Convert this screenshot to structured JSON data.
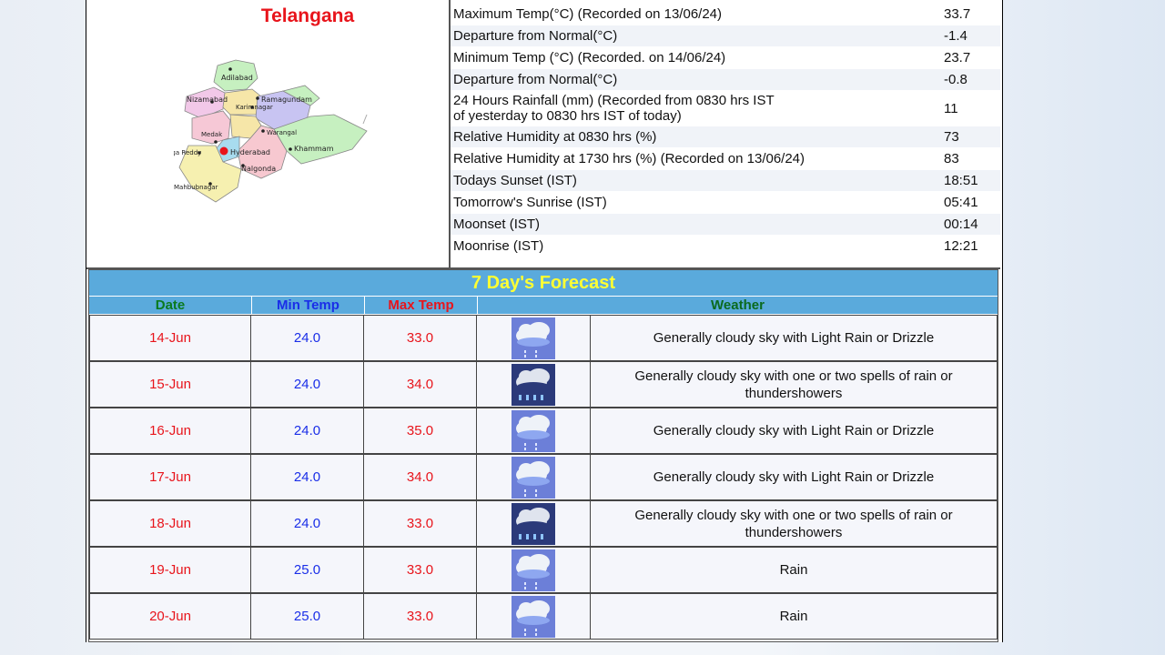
{
  "map": {
    "title": "Telangana",
    "places": [
      "Adilabad",
      "Nizamabad",
      "Ramagundam",
      "Karimnagar",
      "Warangal",
      "Medak",
      "Ranga Reddy",
      "Hyderabad",
      "Khammam",
      "Nalgonda",
      "Mahbubnagar"
    ]
  },
  "observations": [
    {
      "label": "Maximum Temp(°C) (Recorded on 13/06/24)",
      "value": "33.7"
    },
    {
      "label": "Departure from Normal(°C)",
      "value": "-1.4"
    },
    {
      "label": "Minimum Temp (°C) (Recorded. on 14/06/24)",
      "value": "23.7"
    },
    {
      "label": "Departure from Normal(°C)",
      "value": "-0.8"
    },
    {
      "label": "24 Hours Rainfall (mm) (Recorded from 0830 hrs IST",
      "label2": "of yesterday to 0830 hrs IST of today)",
      "value": "11"
    },
    {
      "label": "Relative Humidity at 0830 hrs (%)",
      "value": "73"
    },
    {
      "label": "Relative Humidity at 1730 hrs (%) (Recorded on 13/06/24)",
      "value": "83"
    },
    {
      "label": "Todays Sunset (IST)",
      "value": "18:51"
    },
    {
      "label": "Tomorrow's Sunrise (IST)",
      "value": "05:41"
    },
    {
      "label": "Moonset (IST)",
      "value": "00:14"
    },
    {
      "label": "Moonrise (IST)",
      "value": "12:21"
    }
  ],
  "forecast": {
    "title": "7 Day's Forecast",
    "headers": {
      "date": "Date",
      "min": "Min Temp",
      "max": "Max Temp",
      "weather": "Weather"
    },
    "header_colors": {
      "date": "#0a7a1e",
      "min": "#1a2ee8",
      "max": "#e8141b",
      "weather": "#0a6a1e"
    },
    "rows": [
      {
        "date": "14-Jun",
        "min": "24.0",
        "max": "33.0",
        "icon": "light-rain-icon",
        "weather": "Generally cloudy sky with Light Rain or Drizzle"
      },
      {
        "date": "15-Jun",
        "min": "24.0",
        "max": "34.0",
        "icon": "thundershower-icon",
        "weather": "Generally cloudy sky with one or two spells of rain or thundershowers"
      },
      {
        "date": "16-Jun",
        "min": "24.0",
        "max": "35.0",
        "icon": "light-rain-icon",
        "weather": "Generally cloudy sky with Light Rain or Drizzle"
      },
      {
        "date": "17-Jun",
        "min": "24.0",
        "max": "34.0",
        "icon": "light-rain-icon",
        "weather": "Generally cloudy sky with Light Rain or Drizzle"
      },
      {
        "date": "18-Jun",
        "min": "24.0",
        "max": "33.0",
        "icon": "thundershower-icon",
        "weather": "Generally cloudy sky with one or two spells of rain or thundershowers"
      },
      {
        "date": "19-Jun",
        "min": "25.0",
        "max": "33.0",
        "icon": "rain-icon",
        "weather": "Rain"
      },
      {
        "date": "20-Jun",
        "min": "25.0",
        "max": "33.0",
        "icon": "rain-icon",
        "weather": "Rain"
      }
    ]
  }
}
